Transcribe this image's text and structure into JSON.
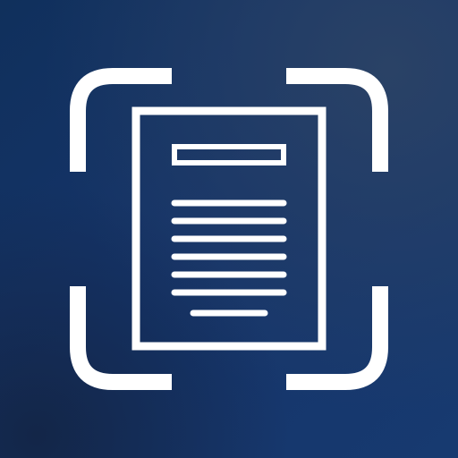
{
  "icon": {
    "semantic_name": "document-scanner-icon",
    "colors": {
      "background_top_left": "#10305c",
      "background_center": "#15346a",
      "background_top_right": "#2a4266",
      "background_bottom_left": "#132648",
      "background_bottom_right": "#173a70",
      "glyph": "#ffffff"
    }
  }
}
